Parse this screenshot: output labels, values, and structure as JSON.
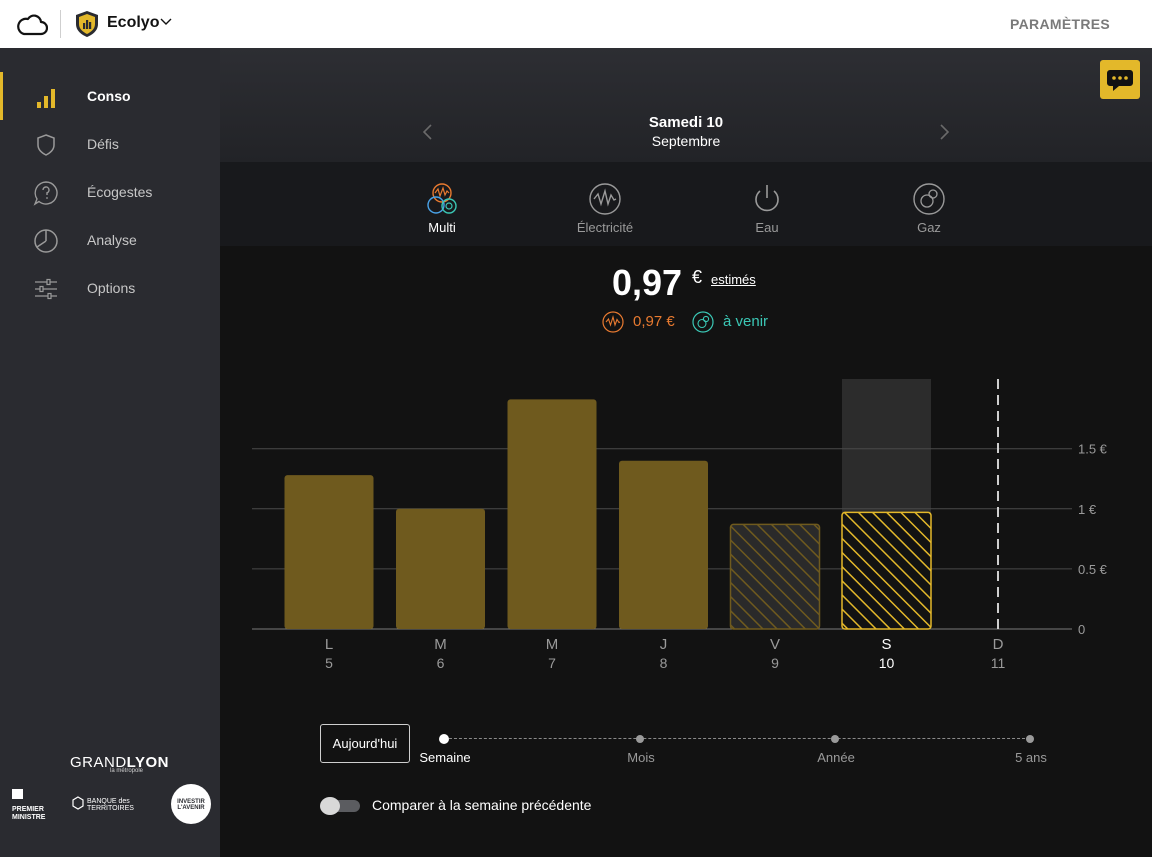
{
  "topbar": {
    "app_name": "Ecolyo",
    "settings_label": "PARAMÈTRES"
  },
  "sidebar": {
    "items": [
      {
        "label": "Conso",
        "icon": "bar-chart-icon",
        "active": true
      },
      {
        "label": "Défis",
        "icon": "shield-icon",
        "active": false
      },
      {
        "label": "Écogestes",
        "icon": "question-bubble-icon",
        "active": false
      },
      {
        "label": "Analyse",
        "icon": "pie-chart-icon",
        "active": false
      },
      {
        "label": "Options",
        "icon": "sliders-icon",
        "active": false
      }
    ],
    "partners": {
      "grandlyon_a": "GRAND",
      "grandlyon_b": "LYON",
      "grandlyon_sub": "la métropole",
      "pm_label": "PREMIER MINISTRE",
      "bdt_label": "BANQUE des TERRITOIRES",
      "ia_label": "INVESTIR L'AVENIR"
    }
  },
  "header": {
    "day": "Samedi 10",
    "month": "Septembre"
  },
  "fluid_tabs": [
    {
      "label": "Multi",
      "icon": "multi-fluid-icon",
      "active": true
    },
    {
      "label": "Électricité",
      "icon": "electricity-icon",
      "active": false
    },
    {
      "label": "Eau",
      "icon": "water-icon",
      "active": false
    },
    {
      "label": "Gaz",
      "icon": "gas-icon",
      "active": false
    }
  ],
  "summary": {
    "amount": "0,97",
    "currency": "€",
    "estimate": "estimés",
    "electricity_amount": "0,97 €",
    "gas_amount": "à venir"
  },
  "colors": {
    "accent": "#e3b82a",
    "bar": "#6f5a1e",
    "electricity": "#e87a30",
    "gas": "#3bc7b5"
  },
  "chart_data": {
    "type": "bar",
    "categories": [
      "L",
      "M",
      "M",
      "J",
      "V",
      "S",
      "D"
    ],
    "category_numbers": [
      "5",
      "6",
      "7",
      "8",
      "9",
      "10",
      "11"
    ],
    "values": [
      1.28,
      1.0,
      1.91,
      1.4,
      0.87,
      0.97,
      null
    ],
    "estimated": [
      false,
      false,
      false,
      false,
      true,
      true,
      false
    ],
    "selected_index": 5,
    "today_index": 6,
    "yticks": [
      0,
      0.5,
      1,
      1.5
    ],
    "ytick_labels": [
      "0",
      "0.5 €",
      "1 €",
      "1.5 €"
    ],
    "ylim": [
      0,
      2.08
    ]
  },
  "timescale": {
    "today_button": "Aujourd'hui",
    "steps": [
      {
        "label": "Semaine",
        "active": true
      },
      {
        "label": "Mois",
        "active": false
      },
      {
        "label": "Année",
        "active": false
      },
      {
        "label": "5 ans",
        "active": false
      }
    ]
  },
  "compare": {
    "label": "Comparer à la semaine précédente",
    "enabled": false
  }
}
